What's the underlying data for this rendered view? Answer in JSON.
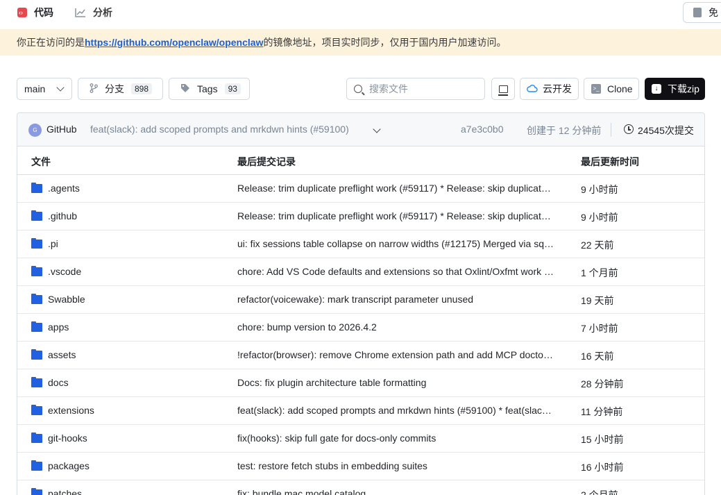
{
  "tabs": {
    "code": "代码",
    "analysis": "分析"
  },
  "free_button": "免",
  "banner": {
    "prefix": "你正在访问的是 ",
    "link": "https://github.com/openclaw/openclaw",
    "suffix": " 的镜像地址，项目实时同步，仅用于国内用户加速访问。"
  },
  "toolbar": {
    "branch": "main",
    "fork_label": "分支",
    "fork_count": "898",
    "tags_label": "Tags",
    "tags_count": "93",
    "search_placeholder": "搜索文件",
    "cloud_dev": "云开发",
    "clone": "Clone",
    "download_zip": "下载zip"
  },
  "latest_commit": {
    "author": "GitHub",
    "message": "feat(slack): add scoped prompts and mrkdwn hints (#59100)",
    "hash": "a7e3c0b0",
    "created": "创建于 12 分钟前",
    "commit_count": "24545次提交"
  },
  "table": {
    "headers": [
      "文件",
      "最后提交记录",
      "最后更新时间"
    ],
    "rows": [
      {
        "name": ".agents",
        "message": "Release: trim duplicate preflight work (#59117) * Release: skip duplicate preflight work",
        "time": "9 小时前"
      },
      {
        "name": ".github",
        "message": "Release: trim duplicate preflight work (#59117) * Release: skip duplicate preflight work",
        "time": "9 小时前"
      },
      {
        "name": ".pi",
        "message": "ui: fix sessions table collapse on narrow widths (#12175) Merged via squash",
        "time": "22 天前"
      },
      {
        "name": ".vscode",
        "message": "chore: Add VS Code defaults and extensions so that Oxlint/Oxfmt work out of the box",
        "time": "1 个月前"
      },
      {
        "name": "Swabble",
        "message": "refactor(voicewake): mark transcript parameter unused",
        "time": "19 天前"
      },
      {
        "name": "apps",
        "message": "chore: bump version to 2026.4.2",
        "time": "7 小时前"
      },
      {
        "name": "assets",
        "message": "!refactor(browser): remove Chrome extension path and add MCP doctor migration",
        "time": "16 天前"
      },
      {
        "name": "docs",
        "message": "Docs: fix plugin architecture table formatting",
        "time": "28 分钟前"
      },
      {
        "name": "extensions",
        "message": "feat(slack): add scoped prompts and mrkdwn hints (#59100) * feat(slack): add scoped prompts",
        "time": "11 分钟前"
      },
      {
        "name": "git-hooks",
        "message": "fix(hooks): skip full gate for docs-only commits",
        "time": "15 小时前"
      },
      {
        "name": "packages",
        "message": "test: restore fetch stubs in embedding suites",
        "time": "16 小时前"
      },
      {
        "name": "patches",
        "message": "fix: bundle mac model catalog",
        "time": "2 个月前"
      }
    ]
  },
  "colors": {
    "banner_bg": "#fdf3dc",
    "link": "#1a5fd6",
    "folder": "#2160e0",
    "primary_button": "#101014"
  }
}
